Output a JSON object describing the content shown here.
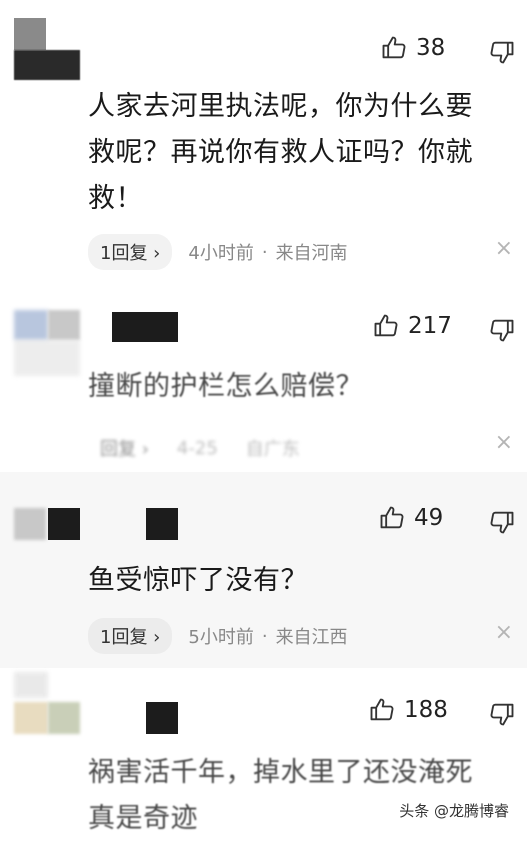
{
  "comments": [
    {
      "likes": "38",
      "text_lines": [
        "人家去河里执法呢，你为什么要",
        "救呢？再说你有救人证吗？你就",
        "救！"
      ],
      "reply_label": "1回复 ›",
      "time": "4小时前",
      "location": "来自河南"
    },
    {
      "likes": "217",
      "text_lines": [
        "撞断的护栏怎么赔偿？"
      ],
      "reply_label": "回复 ›",
      "time": "4-25",
      "location": "自广东"
    },
    {
      "likes": "49",
      "text_lines": [
        "鱼受惊吓了没有？"
      ],
      "reply_label": "1回复 ›",
      "time": "5小时前",
      "location": "来自江西"
    },
    {
      "likes": "188",
      "text_lines": [
        "祸害活千年，掉水里了还没淹死",
        "真是奇迹"
      ]
    }
  ],
  "meta_separator": "·",
  "close_symbol": "×",
  "watermark": "头条 @龙腾博睿"
}
